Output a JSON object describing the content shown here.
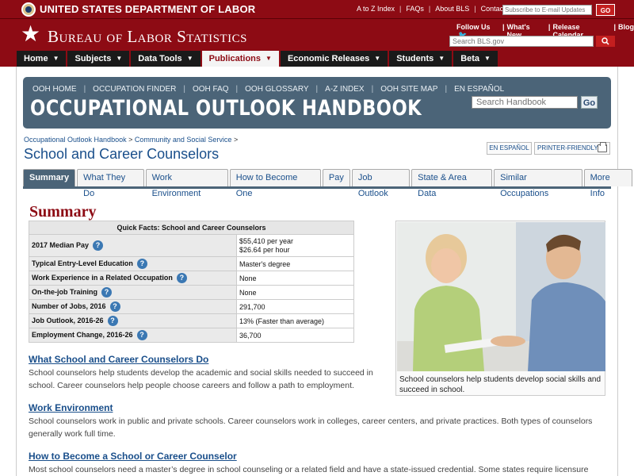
{
  "topbar": {
    "agency": "UNITED STATES DEPARTMENT OF LABOR",
    "links": [
      "A to Z Index",
      "FAQs",
      "About BLS",
      "Contact Us"
    ],
    "subscribe_placeholder": "Subscribe to E-mail Updates",
    "go_label": "GO"
  },
  "header": {
    "title": "Bureau of Labor Statistics",
    "follow_us": "Follow Us",
    "whats_new": "What's New",
    "release_calendar": "Release Calendar",
    "blog": "Blog",
    "search_placeholder": "Search BLS.gov"
  },
  "nav": {
    "items": [
      {
        "label": "Home"
      },
      {
        "label": "Subjects"
      },
      {
        "label": "Data Tools"
      },
      {
        "label": "Publications"
      },
      {
        "label": "Economic Releases"
      },
      {
        "label": "Students"
      },
      {
        "label": "Beta"
      }
    ]
  },
  "ooh": {
    "links": [
      "OOH HOME",
      "OCCUPATION FINDER",
      "OOH FAQ",
      "OOH GLOSSARY",
      "A-Z INDEX",
      "OOH SITE MAP",
      "EN ESPAÑOL"
    ],
    "title": "OCCUPATIONAL OUTLOOK HANDBOOK",
    "search_placeholder": "Search Handbook",
    "go_label": "Go"
  },
  "breadcrumb": {
    "items": [
      "Occupational Outlook Handbook",
      "Community and Social Service"
    ]
  },
  "page": {
    "title": "School and Career Counselors",
    "espanol_label": "EN ESPAÑOL",
    "print_label": "PRINTER-FRIENDLY"
  },
  "tabs": [
    "Summary",
    "What They Do",
    "Work Environment",
    "How to Become One",
    "Pay",
    "Job Outlook",
    "State & Area Data",
    "Similar Occupations",
    "More Info"
  ],
  "summary": {
    "heading": "Summary",
    "table_title": "Quick Facts: School and Career Counselors",
    "rows": [
      {
        "label": "2017 Median Pay",
        "value_line1": "$55,410 per year",
        "value_line2": "$26.64 per hour"
      },
      {
        "label": "Typical Entry-Level Education",
        "value": "Master's degree"
      },
      {
        "label": "Work Experience in a Related Occupation",
        "value": "None"
      },
      {
        "label": "On-the-job Training",
        "value": "None"
      },
      {
        "label": "Number of Jobs, 2016",
        "value": "291,700"
      },
      {
        "label": "Job Outlook, 2016-26",
        "value": "13% (Faster than average)"
      },
      {
        "label": "Employment Change, 2016-26",
        "value": "36,700"
      }
    ],
    "photo_caption": "School counselors help students develop social skills and succeed in school."
  },
  "sections": [
    {
      "link": "What School and Career Counselors Do",
      "text": "School counselors help students develop the academic and social skills needed to succeed in school. Career counselors help people choose careers and follow a path to employment."
    },
    {
      "link": "Work Environment",
      "text": "School counselors work in public and private schools. Career counselors work in colleges, career centers, and private practices. Both types of counselors generally work full time."
    },
    {
      "link": "How to Become a School or Career Counselor",
      "text": "Most school counselors need a master’s degree in school counseling or a related field and have a state-issued credential. Some states require licensure for"
    }
  ]
}
